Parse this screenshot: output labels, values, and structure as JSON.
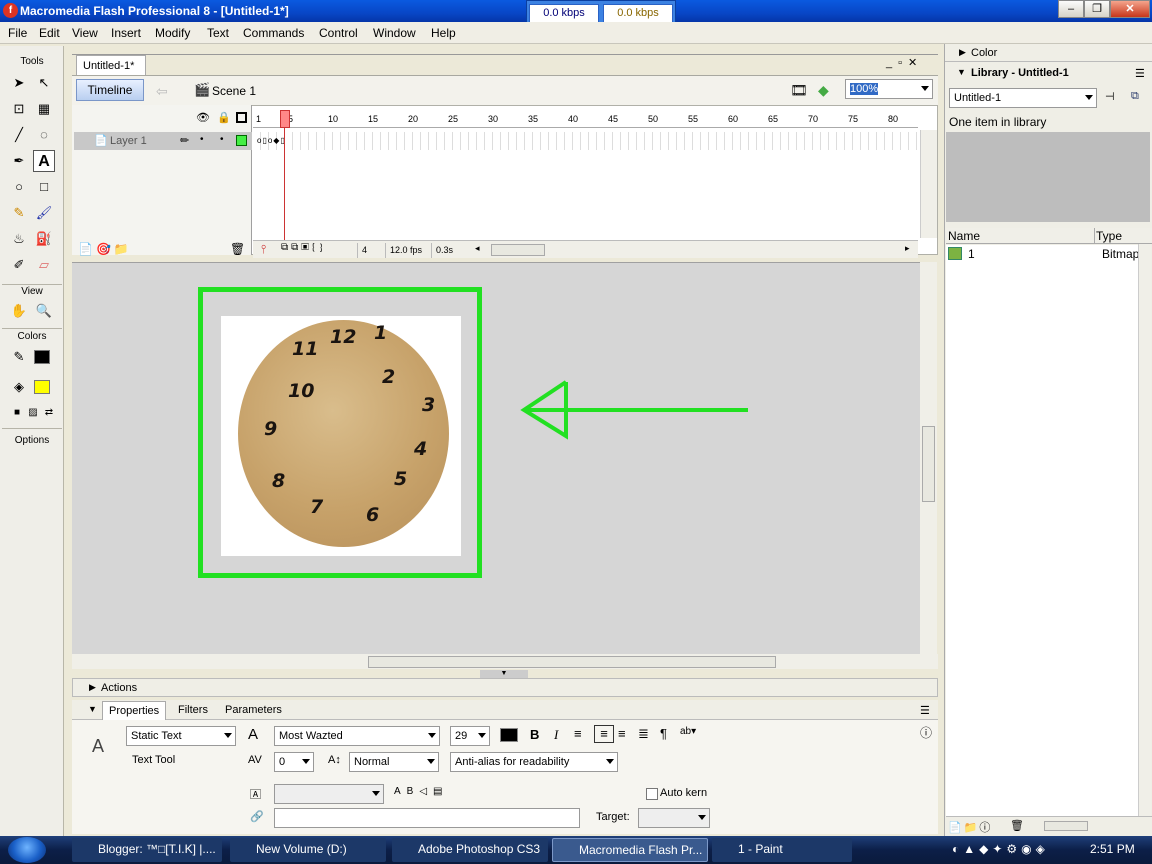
{
  "window": {
    "title": "Macromedia Flash Professional 8 - [Untitled-1*]",
    "kbps_left": "0.0 kbps",
    "kbps_right": "0.0 kbps"
  },
  "menu": [
    "File",
    "Edit",
    "View",
    "Insert",
    "Modify",
    "Text",
    "Commands",
    "Control",
    "Window",
    "Help"
  ],
  "tools": {
    "tools_label": "Tools",
    "view_label": "View",
    "colors_label": "Colors",
    "options_label": "Options"
  },
  "document": {
    "tab": "Untitled-1*",
    "timeline_button": "Timeline",
    "scene": "Scene 1",
    "zoom": "100%"
  },
  "timeline": {
    "layer_name": "Layer 1",
    "ruler": [
      "1",
      "5",
      "10",
      "15",
      "20",
      "25",
      "30",
      "35",
      "40",
      "45",
      "50",
      "55",
      "60",
      "65",
      "70",
      "75",
      "80"
    ],
    "current_frame": "4",
    "fps": "12.0 fps",
    "time": "0.3s"
  },
  "clock_numbers": [
    "12",
    "1",
    "2",
    "3",
    "4",
    "5",
    "6",
    "7",
    "8",
    "9",
    "10",
    "11"
  ],
  "panels": {
    "actions": "Actions",
    "tabs": [
      "Properties",
      "Filters",
      "Parameters"
    ]
  },
  "properties": {
    "text_type": "Static Text",
    "tool_name": "Text Tool",
    "font": "Most Wazted",
    "size": "29",
    "spacing": "0",
    "position": "Normal",
    "antialias": "Anti-alias for readability",
    "auto_kern": "Auto kern",
    "target_label": "Target:"
  },
  "right": {
    "color_title": "Color",
    "library_title": "Library - Untitled-1",
    "library_select": "Untitled-1",
    "library_count": "One item in library",
    "col_name": "Name",
    "col_type": "Type",
    "item_name": "1",
    "item_type": "Bitmap"
  },
  "taskbar": {
    "items": [
      "Blogger: ™□[T.I.K] |....",
      "New Volume (D:)",
      "Adobe Photoshop CS3",
      "Macromedia Flash Pr...",
      "1 - Paint"
    ],
    "time": "2:51 PM"
  },
  "colors": {
    "accent_green": "#22e022",
    "title_blue": "#0a5ae0",
    "fill_yellow": "#ffff00"
  }
}
